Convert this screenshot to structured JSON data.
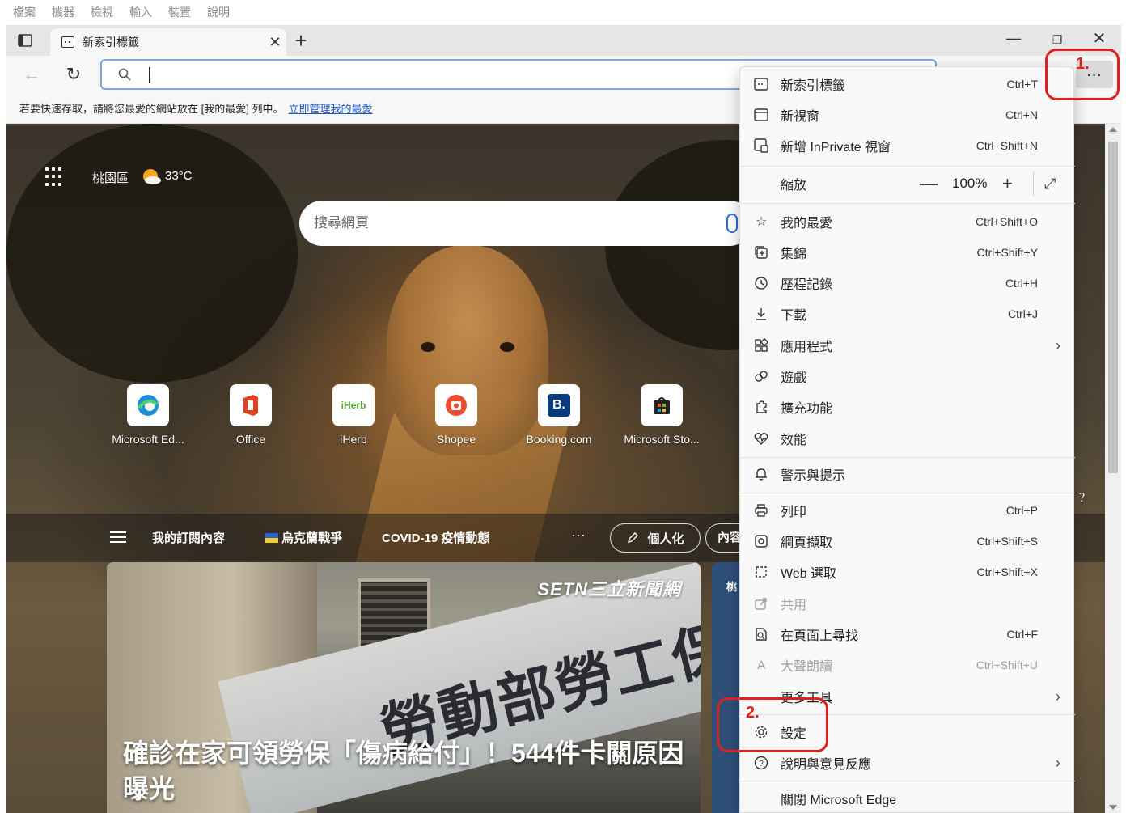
{
  "host_menubar": [
    "檔案",
    "機器",
    "檢視",
    "輸入",
    "裝置",
    "說明"
  ],
  "tab": {
    "title": "新索引標籤",
    "close": "✕"
  },
  "window": {
    "minimize": "—",
    "restore": "❐",
    "close": "✕",
    "new_tab": "+"
  },
  "toolbar": {
    "more": "…",
    "back": "←",
    "refresh": "↻",
    "address_value": ""
  },
  "favorites_bar": {
    "text": "若要快速存取，請將您最愛的網站放在 [我的最愛] 列中。",
    "link": "立即管理我的最愛"
  },
  "weather": {
    "location": "桃園區",
    "temperature": "33°C"
  },
  "page_search": {
    "placeholder": "搜尋網頁"
  },
  "quick_links": [
    {
      "label": "Microsoft Ed...",
      "icon": "edge-icon"
    },
    {
      "label": "Office",
      "icon": "office-icon"
    },
    {
      "label": "iHerb",
      "icon": "iherb-icon"
    },
    {
      "label": "Shopee",
      "icon": "shopee-icon"
    },
    {
      "label": "Booking.com",
      "icon": "booking-icon"
    },
    {
      "label": "Microsoft Sto...",
      "icon": "store-icon"
    }
  ],
  "feed_nav": {
    "my_feed": "我的訂閱內容",
    "ukraine": "烏克蘭戰爭",
    "covid": "COVID-19 疫情動態",
    "more": "···",
    "personalize": "個人化",
    "content": "內容"
  },
  "news": {
    "source": "SETN三立新聞網",
    "headline": "確診在家可領勞保「傷病給付」！544件卡關原因曝光",
    "sign_text": "勞動部勞工保險局",
    "second_card_label": "桃"
  },
  "right_fragment": "？",
  "menu": {
    "items": [
      {
        "label": "新索引標籤",
        "shortcut": "Ctrl+T"
      },
      {
        "label": "新視窗",
        "shortcut": "Ctrl+N"
      },
      {
        "label": "新增 InPrivate 視窗",
        "shortcut": "Ctrl+Shift+N"
      },
      {
        "label": "縮放",
        "zoom": "100%",
        "minus": "—",
        "plus": "+"
      },
      {
        "label": "我的最愛",
        "shortcut": "Ctrl+Shift+O"
      },
      {
        "label": "集錦",
        "shortcut": "Ctrl+Shift+Y"
      },
      {
        "label": "歷程記錄",
        "shortcut": "Ctrl+H"
      },
      {
        "label": "下載",
        "shortcut": "Ctrl+J"
      },
      {
        "label": "應用程式",
        "chevron": "›"
      },
      {
        "label": "遊戲"
      },
      {
        "label": "擴充功能"
      },
      {
        "label": "效能"
      },
      {
        "label": "警示與提示"
      },
      {
        "label": "列印",
        "shortcut": "Ctrl+P"
      },
      {
        "label": "網頁擷取",
        "shortcut": "Ctrl+Shift+S"
      },
      {
        "label": "Web 選取",
        "shortcut": "Ctrl+Shift+X"
      },
      {
        "label": "共用"
      },
      {
        "label": "在頁面上尋找",
        "shortcut": "Ctrl+F"
      },
      {
        "label": "大聲朗讀",
        "shortcut": "Ctrl+Shift+U"
      },
      {
        "label": "更多工具",
        "chevron": "›"
      },
      {
        "label": "設定"
      },
      {
        "label": "說明與意見反應",
        "chevron": "›"
      },
      {
        "label": "關閉 Microsoft Edge"
      }
    ]
  },
  "annotations": {
    "step1": "1.",
    "step2": "2."
  }
}
